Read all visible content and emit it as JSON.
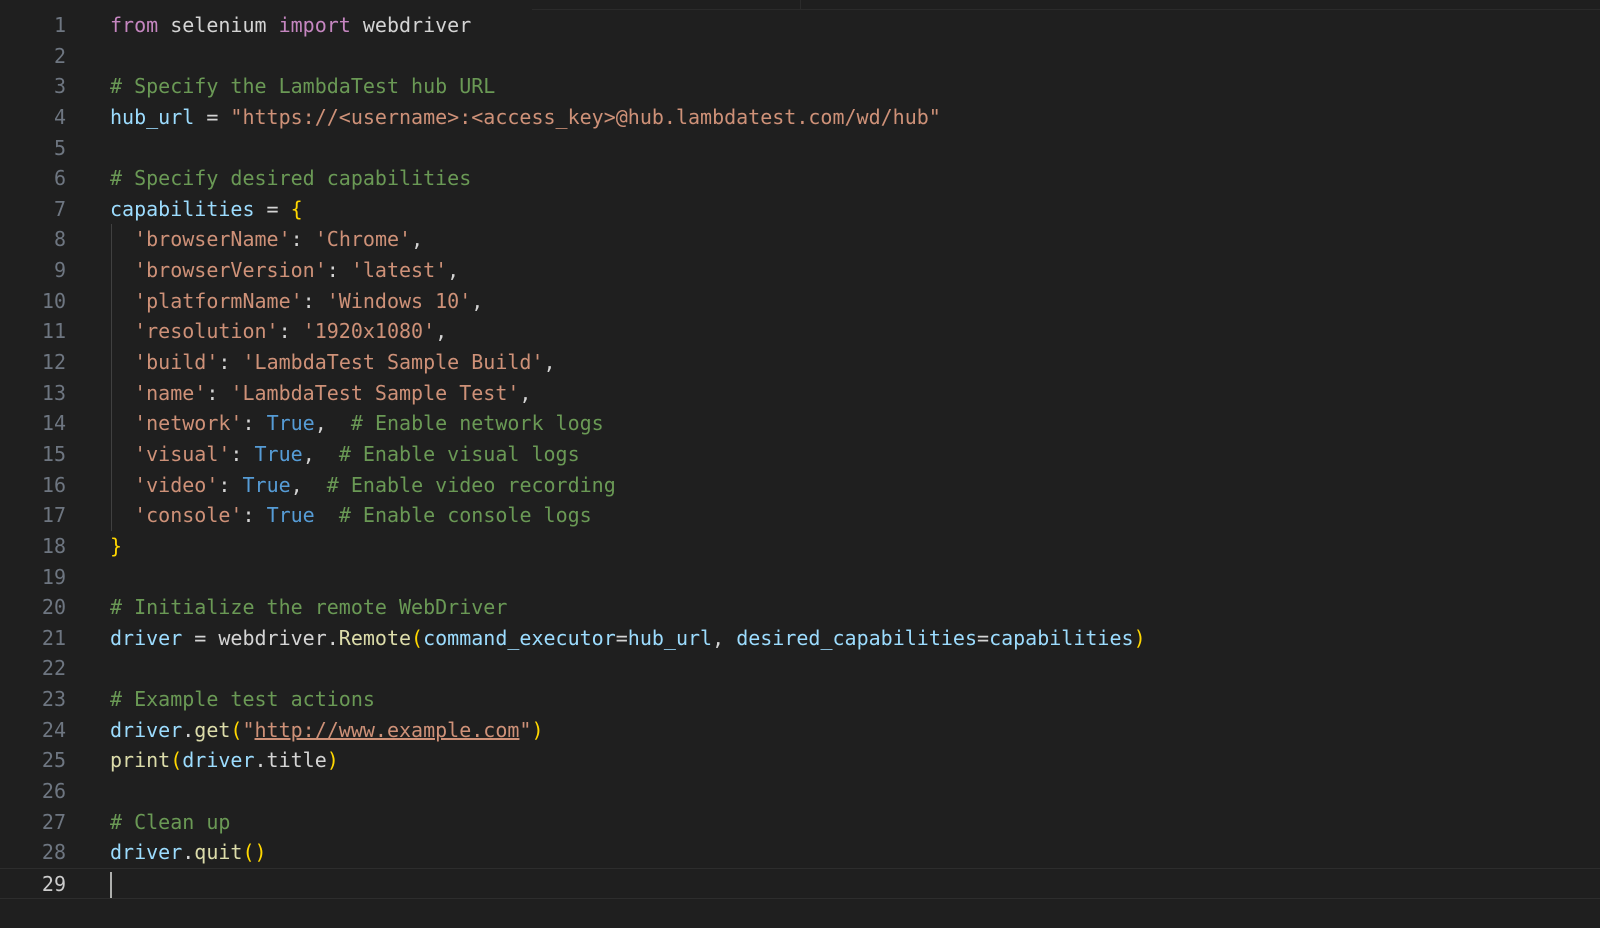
{
  "editor": {
    "current_line": "29",
    "lines": [
      {
        "n": "1",
        "tokens": [
          [
            "kw",
            "from"
          ],
          [
            "txt",
            " selenium "
          ],
          [
            "kw",
            "import"
          ],
          [
            "txt",
            " webdriver"
          ]
        ]
      },
      {
        "n": "2",
        "tokens": []
      },
      {
        "n": "3",
        "tokens": [
          [
            "cm",
            "# Specify the LambdaTest hub URL"
          ]
        ]
      },
      {
        "n": "4",
        "tokens": [
          [
            "var",
            "hub_url"
          ],
          [
            "txt",
            " = "
          ],
          [
            "str",
            "\"https://<username>:<access_key>@hub.lambdatest.com/wd/hub\""
          ]
        ]
      },
      {
        "n": "5",
        "tokens": []
      },
      {
        "n": "6",
        "tokens": [
          [
            "cm",
            "# Specify desired capabilities"
          ]
        ]
      },
      {
        "n": "7",
        "tokens": [
          [
            "var",
            "capabilities"
          ],
          [
            "txt",
            " = "
          ],
          [
            "br",
            "{"
          ]
        ]
      },
      {
        "n": "8",
        "indent": true,
        "tokens": [
          [
            "txt",
            "  "
          ],
          [
            "str",
            "'browserName'"
          ],
          [
            "txt",
            ": "
          ],
          [
            "str",
            "'Chrome'"
          ],
          [
            "txt",
            ","
          ]
        ]
      },
      {
        "n": "9",
        "indent": true,
        "tokens": [
          [
            "txt",
            "  "
          ],
          [
            "str",
            "'browserVersion'"
          ],
          [
            "txt",
            ": "
          ],
          [
            "str",
            "'latest'"
          ],
          [
            "txt",
            ","
          ]
        ]
      },
      {
        "n": "10",
        "indent": true,
        "tokens": [
          [
            "txt",
            "  "
          ],
          [
            "str",
            "'platformName'"
          ],
          [
            "txt",
            ": "
          ],
          [
            "str",
            "'Windows 10'"
          ],
          [
            "txt",
            ","
          ]
        ]
      },
      {
        "n": "11",
        "indent": true,
        "tokens": [
          [
            "txt",
            "  "
          ],
          [
            "str",
            "'resolution'"
          ],
          [
            "txt",
            ": "
          ],
          [
            "str",
            "'1920x1080'"
          ],
          [
            "txt",
            ","
          ]
        ]
      },
      {
        "n": "12",
        "indent": true,
        "tokens": [
          [
            "txt",
            "  "
          ],
          [
            "str",
            "'build'"
          ],
          [
            "txt",
            ": "
          ],
          [
            "str",
            "'LambdaTest Sample Build'"
          ],
          [
            "txt",
            ","
          ]
        ]
      },
      {
        "n": "13",
        "indent": true,
        "tokens": [
          [
            "txt",
            "  "
          ],
          [
            "str",
            "'name'"
          ],
          [
            "txt",
            ": "
          ],
          [
            "str",
            "'LambdaTest Sample Test'"
          ],
          [
            "txt",
            ","
          ]
        ]
      },
      {
        "n": "14",
        "indent": true,
        "tokens": [
          [
            "txt",
            "  "
          ],
          [
            "str",
            "'network'"
          ],
          [
            "txt",
            ": "
          ],
          [
            "bool",
            "True"
          ],
          [
            "txt",
            ",  "
          ],
          [
            "cm",
            "# Enable network logs"
          ]
        ]
      },
      {
        "n": "15",
        "indent": true,
        "tokens": [
          [
            "txt",
            "  "
          ],
          [
            "str",
            "'visual'"
          ],
          [
            "txt",
            ": "
          ],
          [
            "bool",
            "True"
          ],
          [
            "txt",
            ",  "
          ],
          [
            "cm",
            "# Enable visual logs"
          ]
        ]
      },
      {
        "n": "16",
        "indent": true,
        "tokens": [
          [
            "txt",
            "  "
          ],
          [
            "str",
            "'video'"
          ],
          [
            "txt",
            ": "
          ],
          [
            "bool",
            "True"
          ],
          [
            "txt",
            ",  "
          ],
          [
            "cm",
            "# Enable video recording"
          ]
        ]
      },
      {
        "n": "17",
        "indent": true,
        "tokens": [
          [
            "txt",
            "  "
          ],
          [
            "str",
            "'console'"
          ],
          [
            "txt",
            ": "
          ],
          [
            "bool",
            "True"
          ],
          [
            "txt",
            "  "
          ],
          [
            "cm",
            "# Enable console logs"
          ]
        ]
      },
      {
        "n": "18",
        "tokens": [
          [
            "br",
            "}"
          ]
        ]
      },
      {
        "n": "19",
        "tokens": []
      },
      {
        "n": "20",
        "tokens": [
          [
            "cm",
            "# Initialize the remote WebDriver"
          ]
        ]
      },
      {
        "n": "21",
        "tokens": [
          [
            "var",
            "driver"
          ],
          [
            "txt",
            " = webdriver."
          ],
          [
            "fn",
            "Remote"
          ],
          [
            "br",
            "("
          ],
          [
            "var",
            "command_executor"
          ],
          [
            "txt",
            "="
          ],
          [
            "var",
            "hub_url"
          ],
          [
            "txt",
            ", "
          ],
          [
            "var",
            "desired_capabilities"
          ],
          [
            "txt",
            "="
          ],
          [
            "var",
            "capabilities"
          ],
          [
            "br",
            ")"
          ]
        ]
      },
      {
        "n": "22",
        "tokens": []
      },
      {
        "n": "23",
        "tokens": [
          [
            "cm",
            "# Example test actions"
          ]
        ]
      },
      {
        "n": "24",
        "tokens": [
          [
            "var",
            "driver"
          ],
          [
            "txt",
            "."
          ],
          [
            "fn",
            "get"
          ],
          [
            "br",
            "("
          ],
          [
            "str",
            "\""
          ],
          [
            "str link",
            "http://www.example.com"
          ],
          [
            "str",
            "\""
          ],
          [
            "br",
            ")"
          ]
        ]
      },
      {
        "n": "25",
        "tokens": [
          [
            "fn",
            "print"
          ],
          [
            "br",
            "("
          ],
          [
            "var",
            "driver"
          ],
          [
            "txt",
            ".title"
          ],
          [
            "br",
            ")"
          ]
        ]
      },
      {
        "n": "26",
        "tokens": []
      },
      {
        "n": "27",
        "tokens": [
          [
            "cm",
            "# Clean up"
          ]
        ]
      },
      {
        "n": "28",
        "tokens": [
          [
            "var",
            "driver"
          ],
          [
            "txt",
            "."
          ],
          [
            "fn",
            "quit"
          ],
          [
            "br",
            "()"
          ]
        ]
      },
      {
        "n": "29",
        "tokens": [],
        "cursor": true
      }
    ]
  }
}
